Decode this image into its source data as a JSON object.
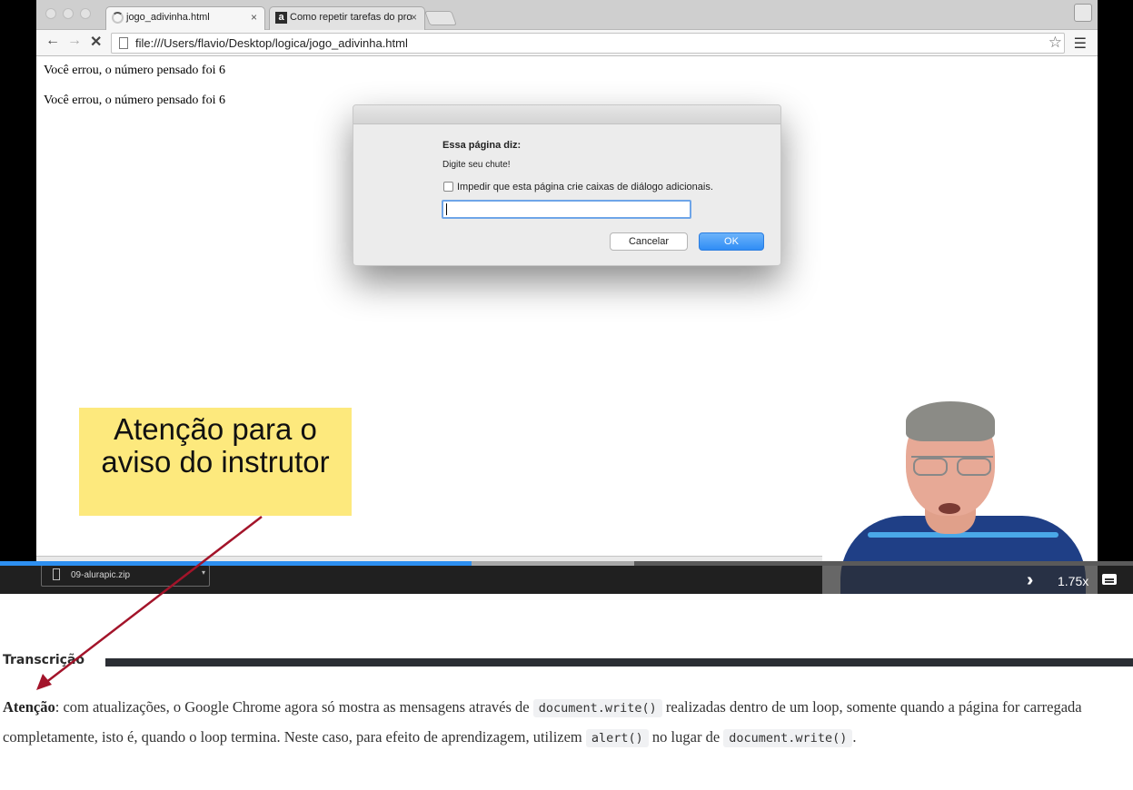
{
  "browser": {
    "tabs": [
      {
        "title": "jogo_adivinha.html",
        "close": "×"
      },
      {
        "title": "Como repetir tarefas do pro",
        "close": "×",
        "favicon_letter": "a"
      }
    ],
    "url": "file:///Users/flavio/Desktop/logica/jogo_adivinha.html"
  },
  "page": {
    "lines": [
      "Você errou, o número pensado foi 6",
      "Você errou, o número pensado foi 6"
    ]
  },
  "dialog": {
    "heading": "Essa página diz:",
    "message": "Digite seu chute!",
    "checkbox_label": "Impedir que esta página crie caixas de diálogo adicionais.",
    "input_value": "",
    "cancel_label": "Cancelar",
    "ok_label": "OK"
  },
  "callout": {
    "text": "Atenção para o aviso do instrutor",
    "color": "#fde97d"
  },
  "player": {
    "download_item": "09-alurapic.zip",
    "speed": "1.75x",
    "progress": 0.416,
    "buffered": 0.56,
    "progress_color": "#2d8ff0"
  },
  "transcript": {
    "heading": "Transcrição",
    "p_strong": "Atenção",
    "p_text1": ": com atualizações, o Google Chrome agora só mostra as mensagens através de ",
    "code1": "document.write()",
    "p_text2": " realizadas dentro de um loop, somente quando a página for carregada completamente, isto é, quando o loop termina. Neste caso, para efeito de aprendizagem, utilizem ",
    "code2": "alert()",
    "p_text3": " no lugar de ",
    "code3": "document.write()",
    "p_text4": "."
  },
  "colors": {
    "annotation_arrow": "#a3142a"
  }
}
